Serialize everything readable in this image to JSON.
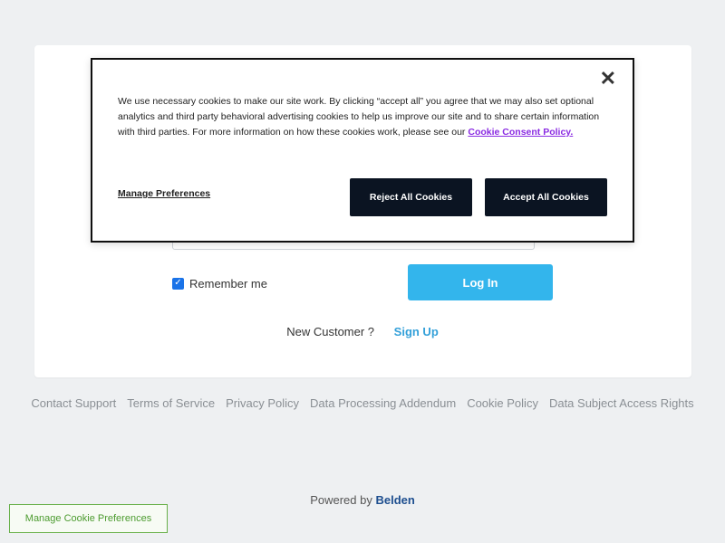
{
  "login": {
    "remember_label": "Remember me",
    "checkbox_glyph": "✓",
    "login_button": "Log In",
    "new_customer": "New Customer ?",
    "sign_up": "Sign Up"
  },
  "footer": {
    "links": [
      "Contact Support",
      "Terms of Service",
      "Privacy Policy",
      "Data Processing Addendum",
      "Cookie Policy",
      "Data Subject Access Rights"
    ],
    "powered_prefix": "Powered by",
    "brand": "Belden"
  },
  "cookie_banner": {
    "close_glyph": "✕",
    "text": "We use necessary cookies to make our site work. By clicking “accept all” you agree that we may also set optional analytics and third party behavioral advertising cookies to help us improve our site and to share certain information with third parties. For more information on how these cookies work, please see our ",
    "policy_link": "Cookie Consent Policy.",
    "manage_preferences": "Manage Preferences",
    "reject_all": "Reject All Cookies",
    "accept_all": "Accept All Cookies"
  },
  "floating_button": {
    "label": "Manage Cookie Preferences"
  },
  "colors": {
    "accent": "#33b5ec",
    "cookie_button": "#0b1422",
    "brand": "#1d4e8f",
    "cookie_link": "#8a2be2",
    "float_border": "#68b04a"
  }
}
